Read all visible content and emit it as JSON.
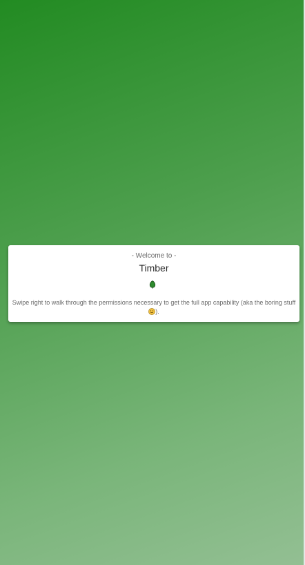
{
  "welcome_card": {
    "pre_title": "- Welcome to -",
    "title": "Timber",
    "description_before": "Swipe right to walk through the permissions necessary to get the full app capability (aka the boring stuff ",
    "description_after": ").",
    "leaf_icon": "leaf-icon",
    "emoji_icon": "neutral-face-emoji"
  },
  "colors": {
    "gradient_start": "#228b22",
    "gradient_end": "#93bf93",
    "card_background": "#ffffff",
    "leaf_color": "#2e8b2e",
    "emoji_color": "#f0c040"
  }
}
